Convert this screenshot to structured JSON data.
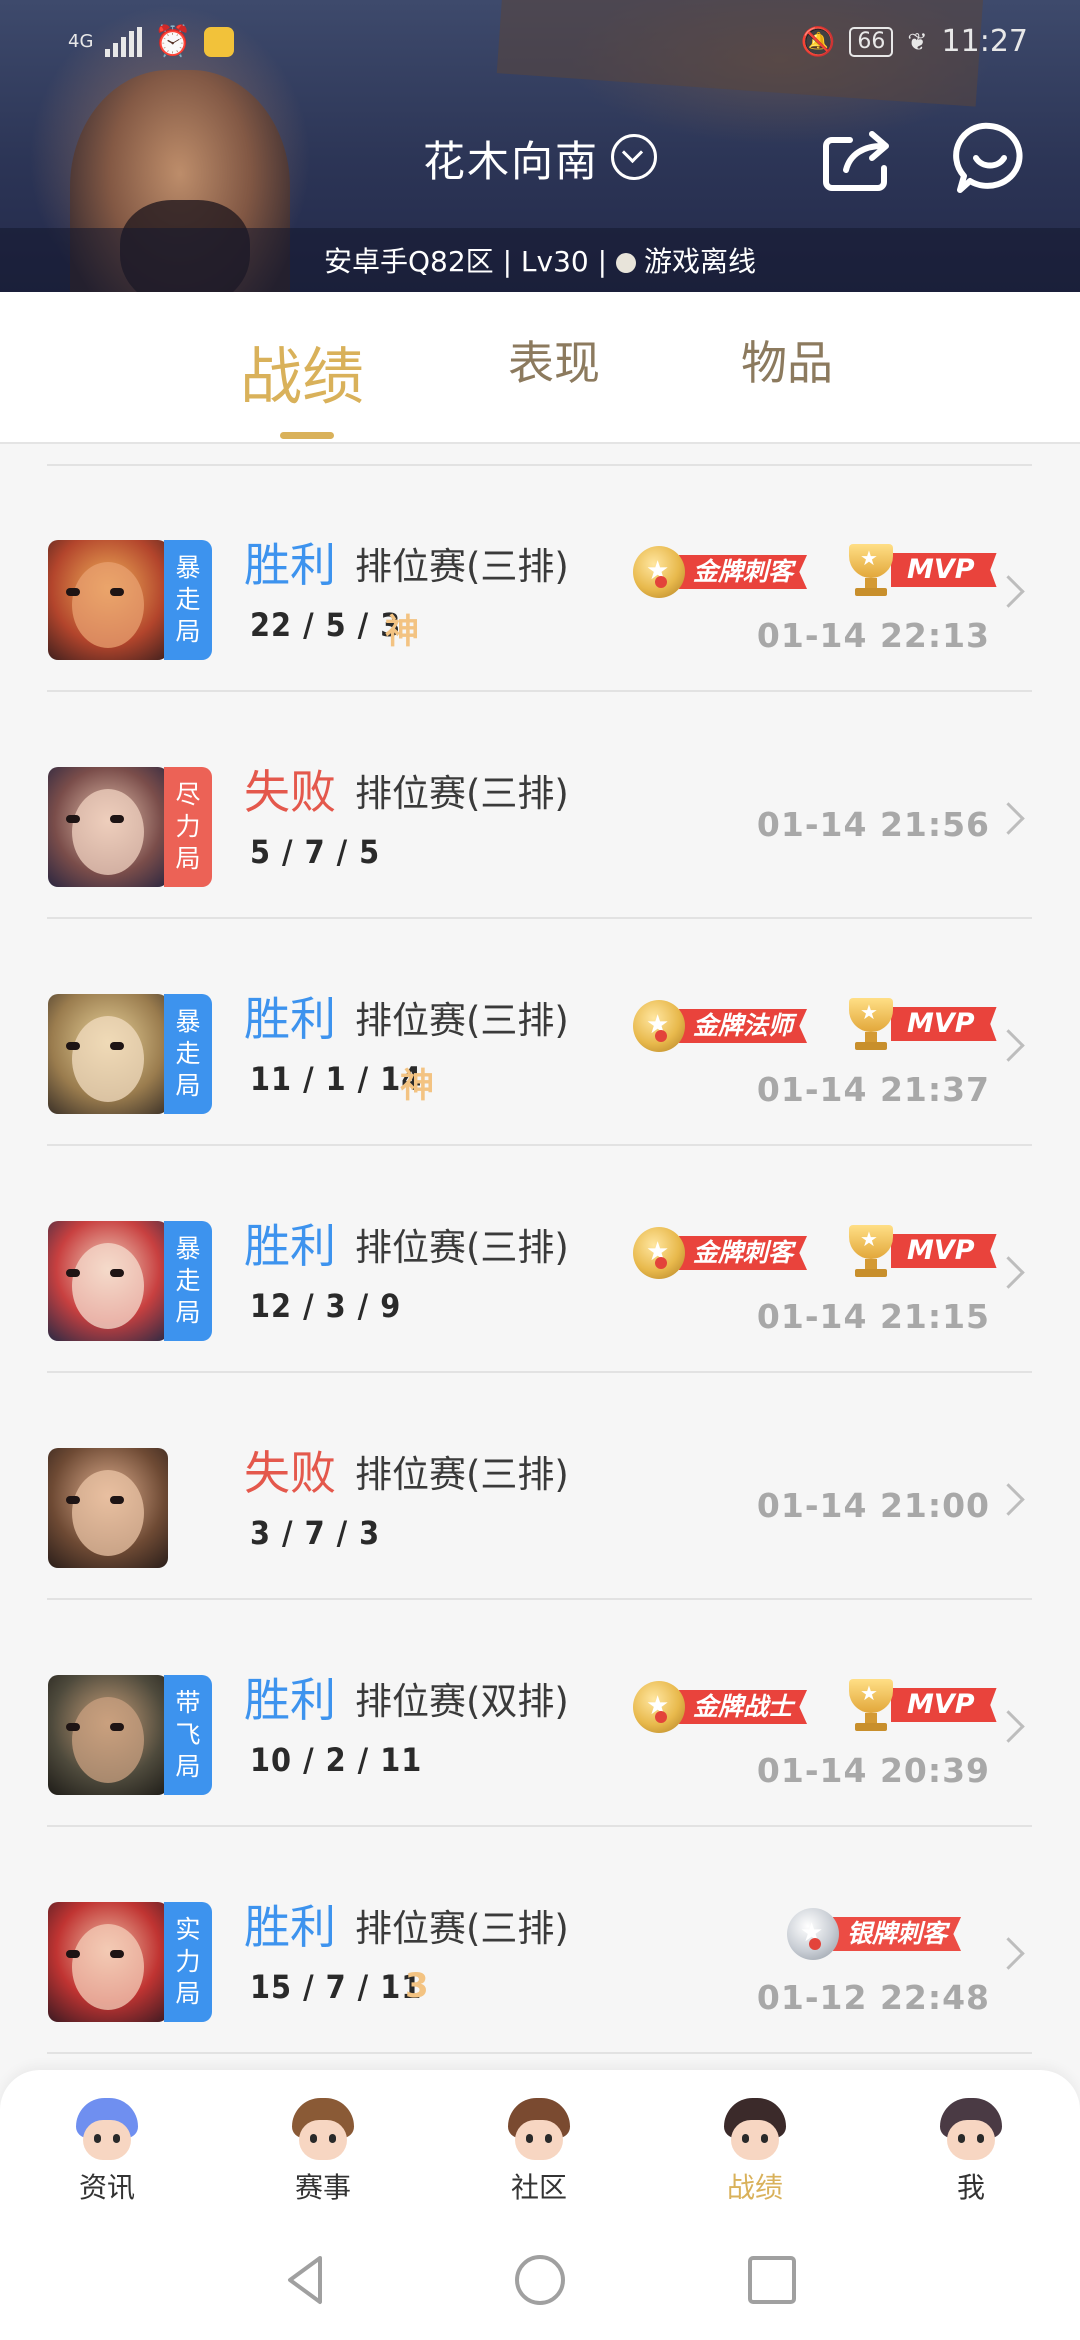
{
  "status_bar": {
    "network": "4G",
    "battery": "66",
    "time": "11:27"
  },
  "header": {
    "player_name": "花木向南",
    "server_info": "安卓手Q82区 | Lv30 | ",
    "status": "游戏离线"
  },
  "tabs": [
    {
      "label": "战绩",
      "active": true
    },
    {
      "label": "表现",
      "active": false
    },
    {
      "label": "物品",
      "active": false
    }
  ],
  "matches": [
    {
      "tag": "暴走局",
      "tag_color": "blue",
      "result": "胜利",
      "win": true,
      "mode": "排位赛(三排)",
      "kda": "22 / 5 / 3",
      "kda_badge": "神",
      "medal": "金牌刺客",
      "medal_type": "gold",
      "mvp": true,
      "mvp_label": "MVP",
      "time": "01-14 22:13"
    },
    {
      "tag": "尽力局",
      "tag_color": "red",
      "result": "失败",
      "win": false,
      "mode": "排位赛(三排)",
      "kda": "5 / 7 / 5",
      "kda_badge": "",
      "medal": "",
      "medal_type": "",
      "mvp": false,
      "mvp_label": "",
      "time": "01-14 21:56"
    },
    {
      "tag": "暴走局",
      "tag_color": "blue",
      "result": "胜利",
      "win": true,
      "mode": "排位赛(三排)",
      "kda": "11 / 1 / 14",
      "kda_badge": "神",
      "medal": "金牌法师",
      "medal_type": "gold",
      "mvp": true,
      "mvp_label": "MVP",
      "time": "01-14 21:37"
    },
    {
      "tag": "暴走局",
      "tag_color": "blue",
      "result": "胜利",
      "win": true,
      "mode": "排位赛(三排)",
      "kda": "12 / 3 / 9",
      "kda_badge": "",
      "medal": "金牌刺客",
      "medal_type": "gold",
      "mvp": true,
      "mvp_label": "MVP",
      "time": "01-14 21:15"
    },
    {
      "tag": "",
      "tag_color": "none",
      "result": "失败",
      "win": false,
      "mode": "排位赛(三排)",
      "kda": "3 / 7 / 3",
      "kda_badge": "",
      "medal": "",
      "medal_type": "",
      "mvp": false,
      "mvp_label": "",
      "time": "01-14 21:00"
    },
    {
      "tag": "带飞局",
      "tag_color": "blue",
      "result": "胜利",
      "win": true,
      "mode": "排位赛(双排)",
      "kda": "10 / 2 / 11",
      "kda_badge": "",
      "medal": "金牌战士",
      "medal_type": "gold",
      "mvp": true,
      "mvp_label": "MVP",
      "time": "01-14 20:39"
    },
    {
      "tag": "实力局",
      "tag_color": "blue",
      "result": "胜利",
      "win": true,
      "mode": "排位赛(三排)",
      "kda": "15 / 7 / 11",
      "kda_badge": "3",
      "medal": "银牌刺客",
      "medal_type": "silver",
      "mvp": false,
      "mvp_label": "",
      "time": "01-12 22:48"
    }
  ],
  "bottom_nav": [
    {
      "label": "资讯",
      "active": false
    },
    {
      "label": "赛事",
      "active": false
    },
    {
      "label": "社区",
      "active": false
    },
    {
      "label": "战绩",
      "active": true
    },
    {
      "label": "我",
      "active": false
    }
  ]
}
